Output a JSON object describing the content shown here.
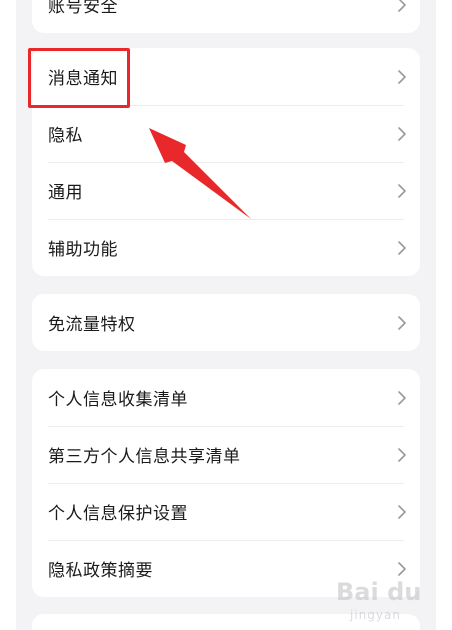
{
  "cards": [
    {
      "items": [
        {
          "label": "账号安全"
        }
      ]
    },
    {
      "items": [
        {
          "label": "消息通知"
        },
        {
          "label": "隐私"
        },
        {
          "label": "通用"
        },
        {
          "label": "辅助功能"
        }
      ]
    },
    {
      "items": [
        {
          "label": "免流量特权"
        }
      ]
    },
    {
      "items": [
        {
          "label": "个人信息收集清单"
        },
        {
          "label": "第三方个人信息共享清单"
        },
        {
          "label": "个人信息保护设置"
        },
        {
          "label": "隐私政策摘要"
        }
      ]
    }
  ],
  "annotation": {
    "highlight_color": "#e8282b",
    "arrow_color": "#e8282b"
  },
  "watermark": {
    "brand": "Bai du",
    "sub": "jingyan"
  },
  "colors": {
    "page_background": "#f3f3f5",
    "card_background": "#ffffff",
    "text": "#1a1a1a",
    "chevron": "#9a9a9e"
  }
}
